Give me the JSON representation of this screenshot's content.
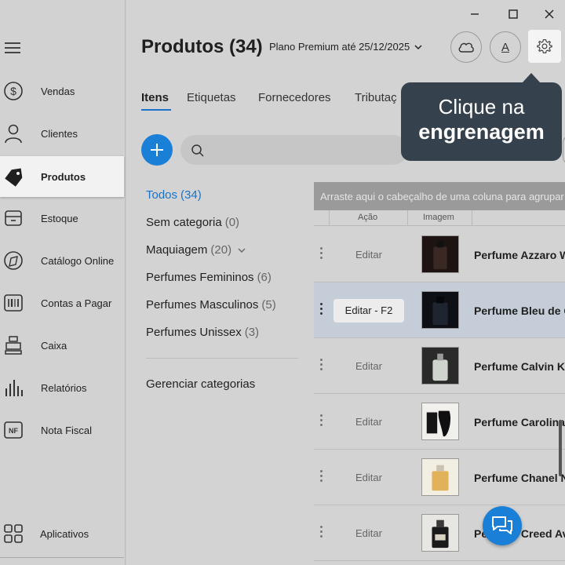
{
  "sidebar": {
    "items": [
      {
        "label": "Vendas",
        "icon": "dollar-icon"
      },
      {
        "label": "Clientes",
        "icon": "user-icon"
      },
      {
        "label": "Produtos",
        "icon": "tag-icon"
      },
      {
        "label": "Estoque",
        "icon": "box-icon"
      },
      {
        "label": "Catálogo Online",
        "icon": "catalog-icon"
      },
      {
        "label": "Contas a Pagar",
        "icon": "barcode-icon"
      },
      {
        "label": "Caixa",
        "icon": "cash-register-icon"
      },
      {
        "label": "Relatórios",
        "icon": "bars-icon"
      },
      {
        "label": "Nota Fiscal",
        "icon": "nf-icon"
      }
    ],
    "apps_label": "Aplicativos",
    "nf_badge": "NF"
  },
  "header": {
    "title": "Produtos (34)",
    "plan": "Plano Premium até 25/12/2025",
    "font_button": "A"
  },
  "tabs": [
    {
      "label": "Itens"
    },
    {
      "label": "Etiquetas"
    },
    {
      "label": "Fornecedores"
    },
    {
      "label": "Tributaç"
    }
  ],
  "tooltip": {
    "line1": "Clique na",
    "line2": "engrenagem"
  },
  "search": {
    "value": "",
    "placeholder": ""
  },
  "categories": {
    "items": [
      {
        "name": "Todos",
        "count": "(34)"
      },
      {
        "name": "Sem categoria",
        "count": "(0)"
      },
      {
        "name": "Maquiagem",
        "count": "(20)"
      },
      {
        "name": "Perfumes Femininos",
        "count": "(6)"
      },
      {
        "name": "Perfumes Masculinos",
        "count": "(5)"
      },
      {
        "name": "Perfumes Unissex",
        "count": "(3)"
      }
    ],
    "manage": "Gerenciar categorias"
  },
  "grid": {
    "group_hint": "Arraste aqui o cabeçalho de uma coluna para agrupar",
    "columns": {
      "action": "Ação",
      "image": "Imagem"
    },
    "rows": [
      {
        "edit": "Editar",
        "name": "Perfume Azzaro W"
      },
      {
        "edit": "Editar - F2",
        "name": "Perfume Bleu de C"
      },
      {
        "edit": "Editar",
        "name": "Perfume Calvin K"
      },
      {
        "edit": "Editar",
        "name": "Perfume Carolina"
      },
      {
        "edit": "Editar",
        "name": "Perfume Chanel N"
      },
      {
        "edit": "Editar",
        "name": "Perfume Creed Av"
      }
    ]
  },
  "colors": {
    "accent": "#1a7fd6",
    "tooltip_bg": "#36414e",
    "row_highlight": "#c5ced8"
  }
}
